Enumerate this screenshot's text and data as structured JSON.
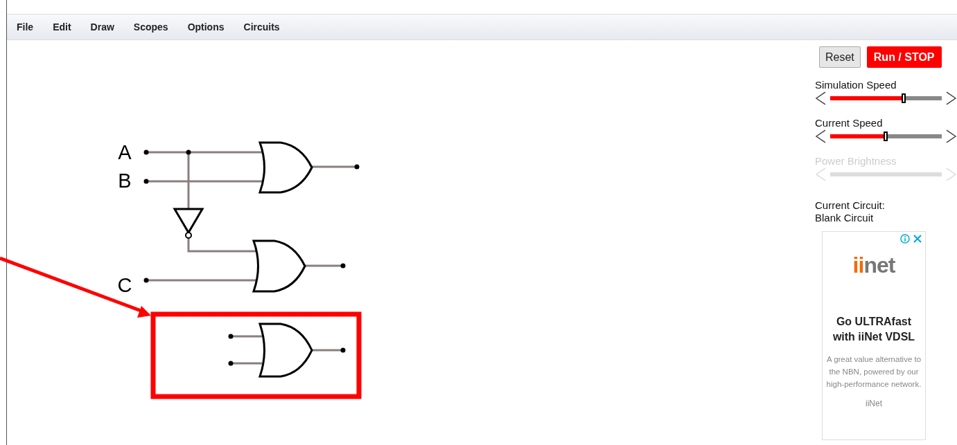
{
  "menu": [
    "File",
    "Edit",
    "Draw",
    "Scopes",
    "Options",
    "Circuits"
  ],
  "buttons": [
    {
      "label": "Reset",
      "kind": "plain"
    },
    {
      "label": "Run / STOP",
      "kind": "run"
    }
  ],
  "sliders": [
    {
      "label": "Simulation Speed",
      "level": 0.67,
      "disabled": false
    },
    {
      "label": "Current Speed",
      "level": 0.51,
      "disabled": false
    },
    {
      "label": "Power Brightness",
      "disabled": true
    }
  ],
  "current_circuit": {
    "label": "Current Circuit:",
    "value": "Blank Circuit"
  },
  "circuit": {
    "inputs": [
      "A",
      "B",
      "C"
    ]
  },
  "ad": {
    "logo": "iinet",
    "headline": "Go ULTRAfast with iiNet VDSL",
    "body": "A great value alternative to the NBN, powered by our high-performance network.",
    "advertiser": "iiNet"
  }
}
